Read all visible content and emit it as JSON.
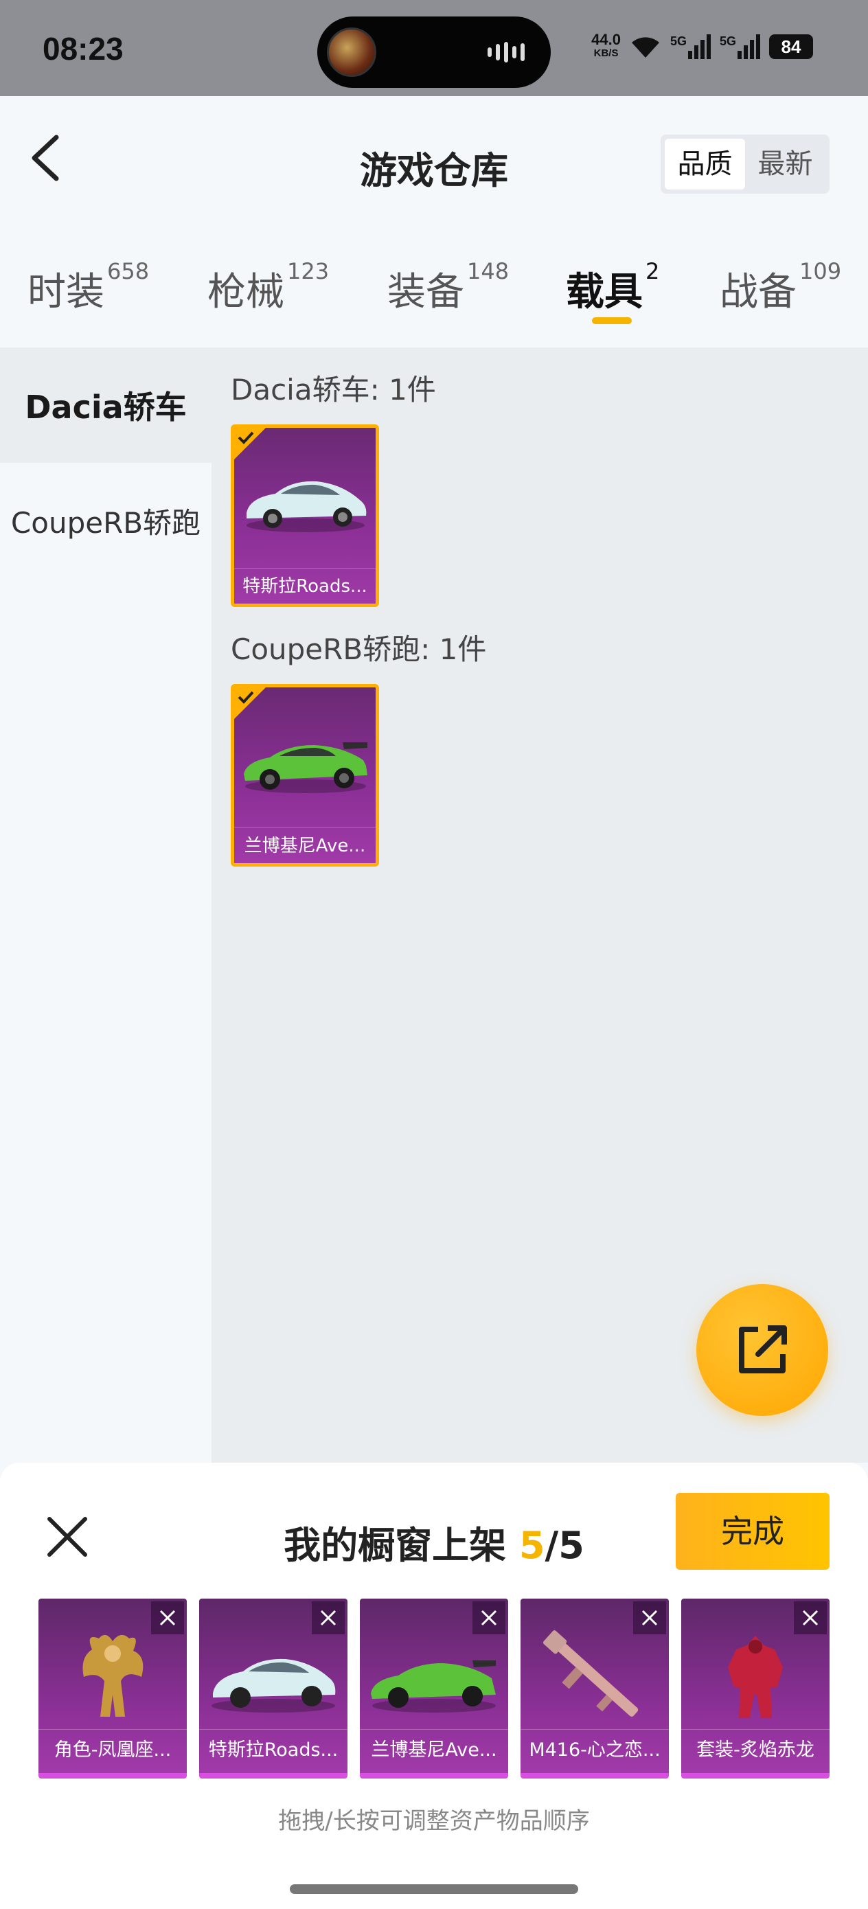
{
  "status_bar": {
    "time": "08:23",
    "net_speed": "44.0",
    "net_unit": "KB/S",
    "signal_1": "5G",
    "signal_2": "5G",
    "battery": "84"
  },
  "header": {
    "title": "游戏仓库",
    "sort_options": [
      "品质",
      "最新"
    ],
    "sort_active": "品质"
  },
  "tabs": [
    {
      "label": "时装",
      "count": "658"
    },
    {
      "label": "枪械",
      "count": "123"
    },
    {
      "label": "装备",
      "count": "148"
    },
    {
      "label": "载具",
      "count": "2",
      "active": true
    },
    {
      "label": "战备",
      "count": "109"
    }
  ],
  "sidebar": {
    "items": [
      {
        "label": "Dacia轿车",
        "active": true
      },
      {
        "label": "CoupeRB轿跑"
      }
    ]
  },
  "groups": [
    {
      "title": "Dacia轿车: 1件",
      "items": [
        {
          "name": "特斯拉Roads...",
          "selected": true,
          "color": "#cfe3e6"
        }
      ]
    },
    {
      "title": "CoupeRB轿跑: 1件",
      "items": [
        {
          "name": "兰博基尼Ave...",
          "selected": true,
          "color": "#5cc23a"
        }
      ]
    }
  ],
  "fab": {
    "icon": "share-external-icon"
  },
  "sheet": {
    "title_prefix": "我的橱窗上架 ",
    "count_current": "5",
    "count_total": "/5",
    "done_label": "完成",
    "items": [
      {
        "name": "角色-凤凰座...",
        "icon": "phoenix-character-icon"
      },
      {
        "name": "特斯拉Roads...",
        "icon": "white-car-icon"
      },
      {
        "name": "兰博基尼Ave...",
        "icon": "green-car-icon"
      },
      {
        "name": "M416-心之恋...",
        "icon": "rifle-icon"
      },
      {
        "name": "套装-炙焰赤龙",
        "icon": "red-dragon-suit-icon"
      }
    ],
    "hint": "拖拽/长按可调整资产物品顺序"
  },
  "colors": {
    "accent": "#f5b400",
    "card_purple": "#8a2f95",
    "selected_border": "#ffb000"
  }
}
